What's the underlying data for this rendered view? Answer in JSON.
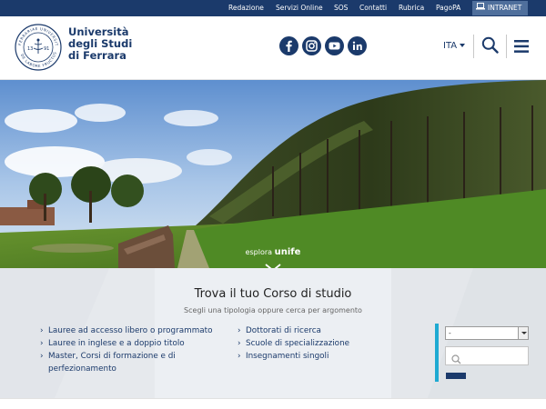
{
  "topbar": {
    "links": [
      "Redazione",
      "Servizi Online",
      "SOS",
      "Contatti",
      "Rubrica",
      "PagoPA"
    ],
    "intranet": "INTRANET"
  },
  "header": {
    "name_lines": [
      "Università",
      "degli Studi",
      "di Ferrara"
    ],
    "logo": {
      "ring_text": "FERRARIAE UNIVERSITAS · DE LABORE FRUCTUS",
      "year_left": "13",
      "year_right": "91"
    },
    "social_icons": [
      "facebook-icon",
      "instagram-icon",
      "youtube-icon",
      "linkedin-icon"
    ],
    "lang": "ITA"
  },
  "hero": {
    "explore_prefix": "esplora",
    "explore_word": "unife"
  },
  "finder": {
    "title": "Trova il tuo Corso di studio",
    "subtitle": "Scegli una tipologia oppure cerca per argomento",
    "left_links": [
      "Lauree ad accesso libero o programmato",
      "Lauree in inglese e a doppio titolo",
      "Master, Corsi di formazione e di",
      "perfezionamento"
    ],
    "right_links": [
      "Dottorati di ricerca",
      "Scuole di specializzazione",
      "Insegnamenti singoli"
    ],
    "select_value": "-"
  },
  "colors": {
    "brand": "#1b3a6b",
    "accent": "#1eaad2",
    "finder_bg": "#eceff3"
  }
}
